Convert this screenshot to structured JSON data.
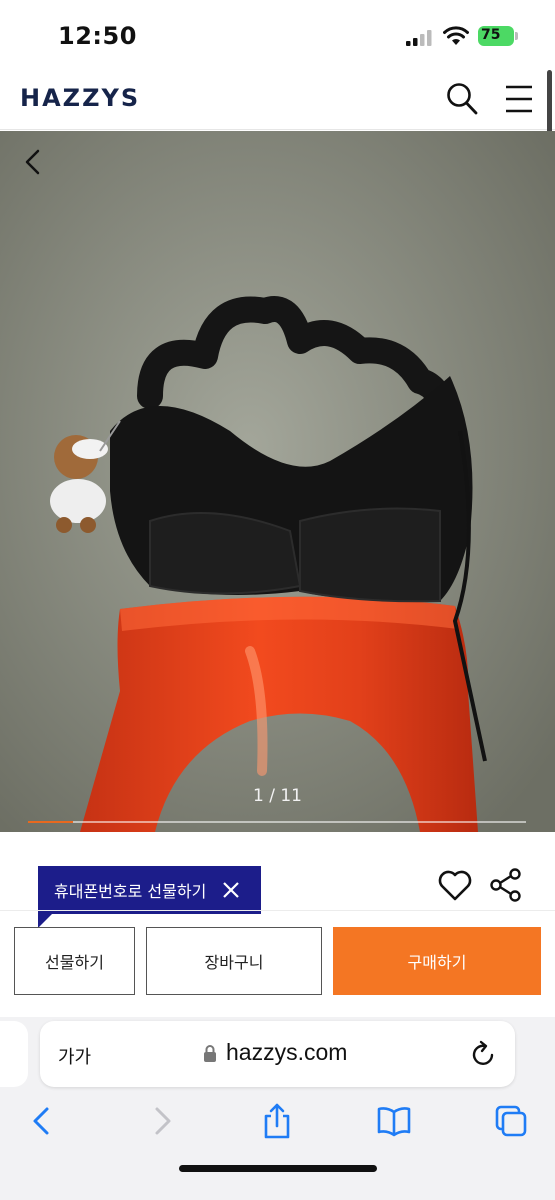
{
  "status_bar": {
    "time": "12:50",
    "battery": "75",
    "icons": [
      "cellular-signal-icon",
      "wifi-icon",
      "battery-icon"
    ]
  },
  "header": {
    "logo": "HAZZYS",
    "icons": [
      "search-icon",
      "menu-icon"
    ]
  },
  "gallery": {
    "counter": "1 / 11",
    "current": 1,
    "total": 11,
    "progress_fraction": 0.09
  },
  "actions": {
    "gift_tooltip": "휴대폰번호로 선물하기",
    "gift_button": "선물하기",
    "cart_button": "장바구니",
    "buy_button": "구매하기",
    "icons": [
      "heart-icon",
      "share-icon",
      "close-icon"
    ]
  },
  "browser": {
    "text_size": "가가",
    "url": "hazzys.com",
    "icons": [
      "lock-icon",
      "reload-icon",
      "back-icon",
      "forward-icon",
      "share-icon",
      "bookmarks-icon",
      "tabs-icon"
    ]
  },
  "colors": {
    "brand_navy": "#16244a",
    "tooltip_blue": "#1c1d8a",
    "buy_orange": "#f47623",
    "progress_orange": "#e8691f"
  }
}
